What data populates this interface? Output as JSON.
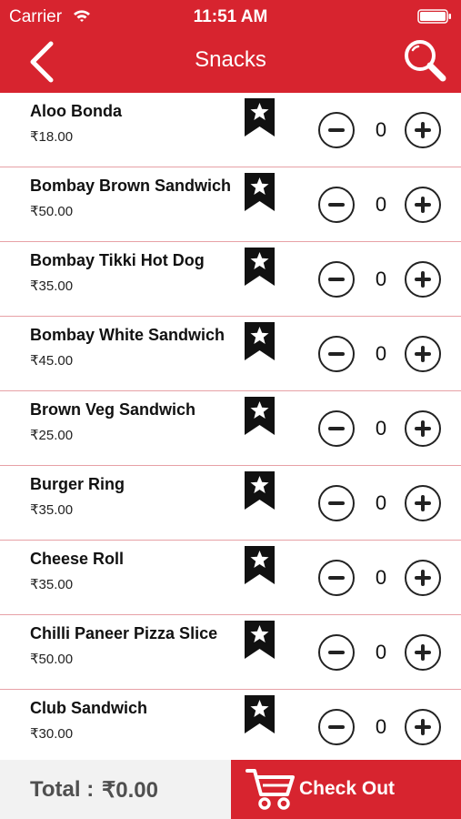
{
  "status_bar": {
    "carrier": "Carrier",
    "time": "11:51 AM"
  },
  "nav": {
    "title": "Snacks",
    "back_icon": "chevron-left-icon",
    "search_icon": "search-icon"
  },
  "items": [
    {
      "name": "Aloo Bonda",
      "price": "₹18.00",
      "qty": "0"
    },
    {
      "name": "Bombay Brown Sandwich",
      "price": "₹50.00",
      "qty": "0"
    },
    {
      "name": "Bombay Tikki Hot Dog",
      "price": "₹35.00",
      "qty": "0"
    },
    {
      "name": "Bombay White Sandwich",
      "price": "₹45.00",
      "qty": "0"
    },
    {
      "name": "Brown Veg Sandwich",
      "price": "₹25.00",
      "qty": "0"
    },
    {
      "name": "Burger Ring",
      "price": "₹35.00",
      "qty": "0"
    },
    {
      "name": "Cheese Roll",
      "price": "₹35.00",
      "qty": "0"
    },
    {
      "name": "Chilli Paneer Pizza Slice",
      "price": "₹50.00",
      "qty": "0"
    },
    {
      "name": "Club Sandwich",
      "price": "₹30.00",
      "qty": "0"
    }
  ],
  "footer": {
    "total_label": "Total :",
    "total_value": "₹0.00",
    "checkout_label": "Check Out"
  },
  "colors": {
    "brand_red": "#d7242f",
    "divider": "#e7a1a6",
    "footer_gray": "#f2f2f2",
    "total_text": "#4f4f4f"
  }
}
